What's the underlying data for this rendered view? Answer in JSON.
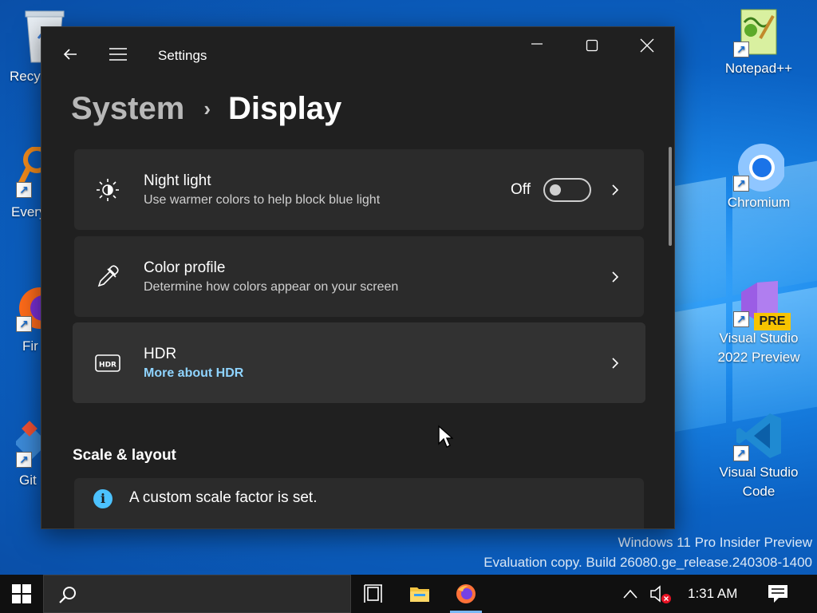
{
  "desktop": {
    "icons_right": [
      {
        "label": "Notepad++",
        "icon": "notepadpp-icon"
      },
      {
        "label": "Chromium",
        "icon": "chromium-icon"
      },
      {
        "label_line1": "Visual Studio",
        "label_line2": "2022 Preview",
        "badge": "PRE",
        "icon": "visual-studio-preview-icon"
      },
      {
        "label_line1": "Visual Studio",
        "label_line2": "Code",
        "icon": "vscode-icon"
      }
    ],
    "icons_left": [
      {
        "label": "Recy",
        "icon": "recycle-bin-icon"
      },
      {
        "label": "Every",
        "icon": "everything-icon"
      },
      {
        "label": "Fir",
        "icon": "firefox-icon"
      },
      {
        "label": "Git",
        "icon": "git-icon"
      }
    ],
    "watermark": {
      "line1": "Windows 11 Pro Insider Preview",
      "line2": "Evaluation copy. Build 26080.ge_release.240308-1400"
    }
  },
  "window": {
    "app_title": "Settings",
    "back_icon": "back-arrow-icon",
    "menu_icon": "hamburger-menu-icon",
    "caption_buttons": [
      "minimize",
      "maximize",
      "close"
    ],
    "breadcrumb": {
      "parent": "System",
      "separator": "›",
      "current": "Display"
    },
    "cards": [
      {
        "title": "Night light",
        "subtitle": "Use warmer colors to help block blue light",
        "icon": "night-light-icon",
        "toggle_label": "Off",
        "toggle_on": false
      },
      {
        "title": "Color profile",
        "subtitle": "Determine how colors appear on your screen",
        "icon": "eyedropper-icon"
      },
      {
        "title": "HDR",
        "link": "More about HDR",
        "icon": "hdr-icon"
      }
    ],
    "section_title": "Scale & layout",
    "info_message": "A custom scale factor is set.",
    "info_icon_glyph": "i"
  },
  "taskbar": {
    "clock": "1:31 AM",
    "items": [
      "start-icon",
      "search-icon",
      "task-view-icon",
      "file-explorer-icon",
      "firefox-icon"
    ],
    "tray": [
      "chevron-up-icon",
      "volume-muted-icon",
      "notifications-icon"
    ]
  }
}
